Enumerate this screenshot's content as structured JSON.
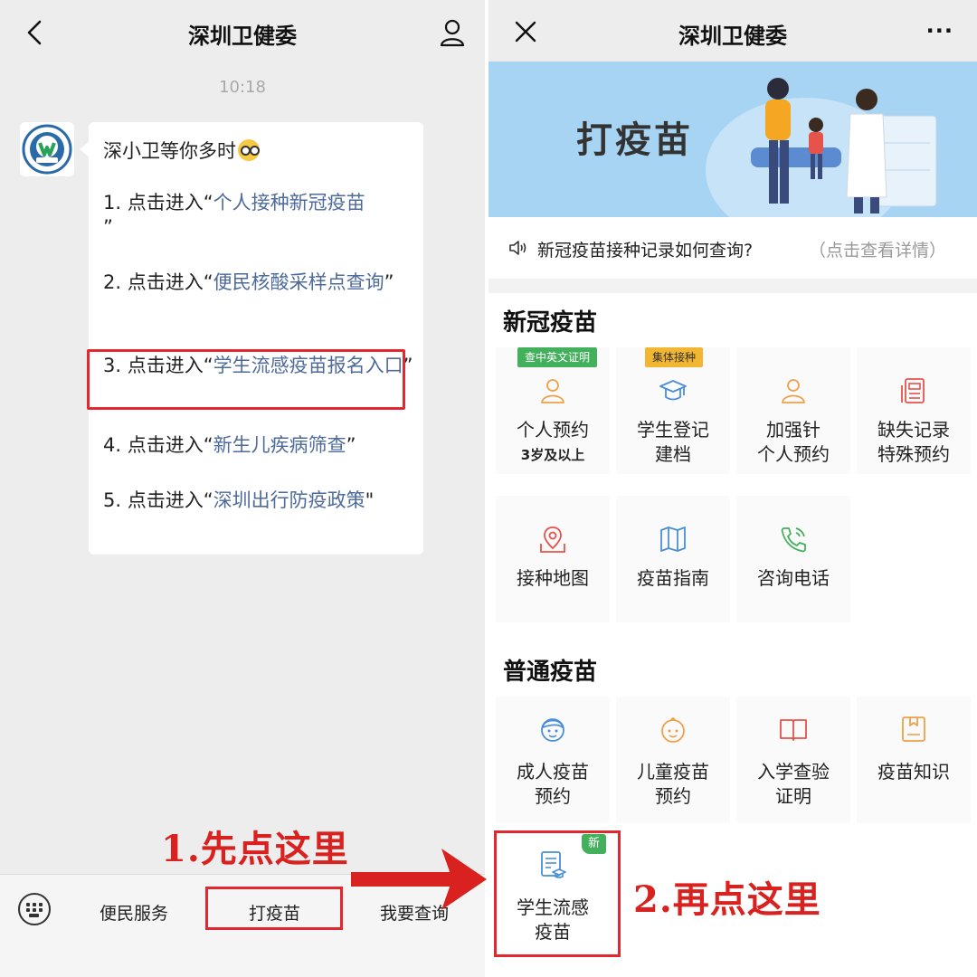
{
  "left": {
    "title": "深圳卫健委",
    "time": "10:18",
    "message": {
      "greeting": "深小卫等你多时",
      "items": [
        {
          "prefix": "1. 点击进入“",
          "link": "个人接种新冠疫苗",
          "suffix": "”"
        },
        {
          "prefix": "2. 点击进入“",
          "link": "便民核酸采样点查询",
          "suffix": "”"
        },
        {
          "prefix": "3. 点击进入“",
          "link": "学生流感疫苗报名入口",
          "suffix": "”"
        },
        {
          "prefix": "4. 点击进入“",
          "link": "新生儿疾病筛查",
          "suffix": "”"
        },
        {
          "prefix": "5. 点击进入“",
          "link": "深圳出行防疫政策",
          "suffix": "\""
        }
      ]
    },
    "menu": [
      "便民服务",
      "打疫苗",
      "我要查询"
    ],
    "step_label": "1.先点这里"
  },
  "right": {
    "title": "深圳卫健委",
    "more": "···",
    "banner_title": "打疫苗",
    "notice": {
      "text": "新冠疫苗接种记录如何查询?",
      "hint": "（点击查看详情）"
    },
    "sections": [
      {
        "title": "新冠疫苗",
        "items": [
          {
            "tag": "查中英文证明",
            "line1": "个人预约",
            "line2": "3岁及以上",
            "icon": "person-icon"
          },
          {
            "tag": "集体接种",
            "line1": "学生登记",
            "line2": "建档",
            "icon": "graduation-cap-icon"
          },
          {
            "line1": "加强针",
            "line2": "个人预约",
            "icon": "person-icon"
          },
          {
            "line1": "缺失记录",
            "line2": "特殊预约",
            "icon": "document-icon"
          },
          {
            "line1": "接种地图",
            "icon": "map-pin-icon"
          },
          {
            "line1": "疫苗指南",
            "icon": "map-book-icon"
          },
          {
            "line1": "咨询电话",
            "icon": "phone-icon"
          }
        ]
      },
      {
        "title": "普通疫苗",
        "items": [
          {
            "line1": "成人疫苗",
            "line2": "预约",
            "icon": "adult-face-icon"
          },
          {
            "line1": "儿童疫苗",
            "line2": "预约",
            "icon": "baby-face-icon"
          },
          {
            "line1": "入学查验",
            "line2": "证明",
            "icon": "open-book-icon"
          },
          {
            "line1": "疫苗知识",
            "icon": "notebook-icon"
          },
          {
            "badge": "新",
            "line1": "学生流感",
            "line2": "疫苗",
            "icon": "student-doc-icon"
          }
        ]
      }
    ],
    "step_label": "2.再点这里"
  },
  "colors": {
    "highlight_red": "#e0282e",
    "link_blue": "#4e6b9b",
    "icon_orange": "#f0a048",
    "icon_blue": "#4a8fd6",
    "icon_green": "#43b05c",
    "icon_red": "#e5534b",
    "tag_green": "#43b05c",
    "tag_yellow": "#f2b632"
  }
}
